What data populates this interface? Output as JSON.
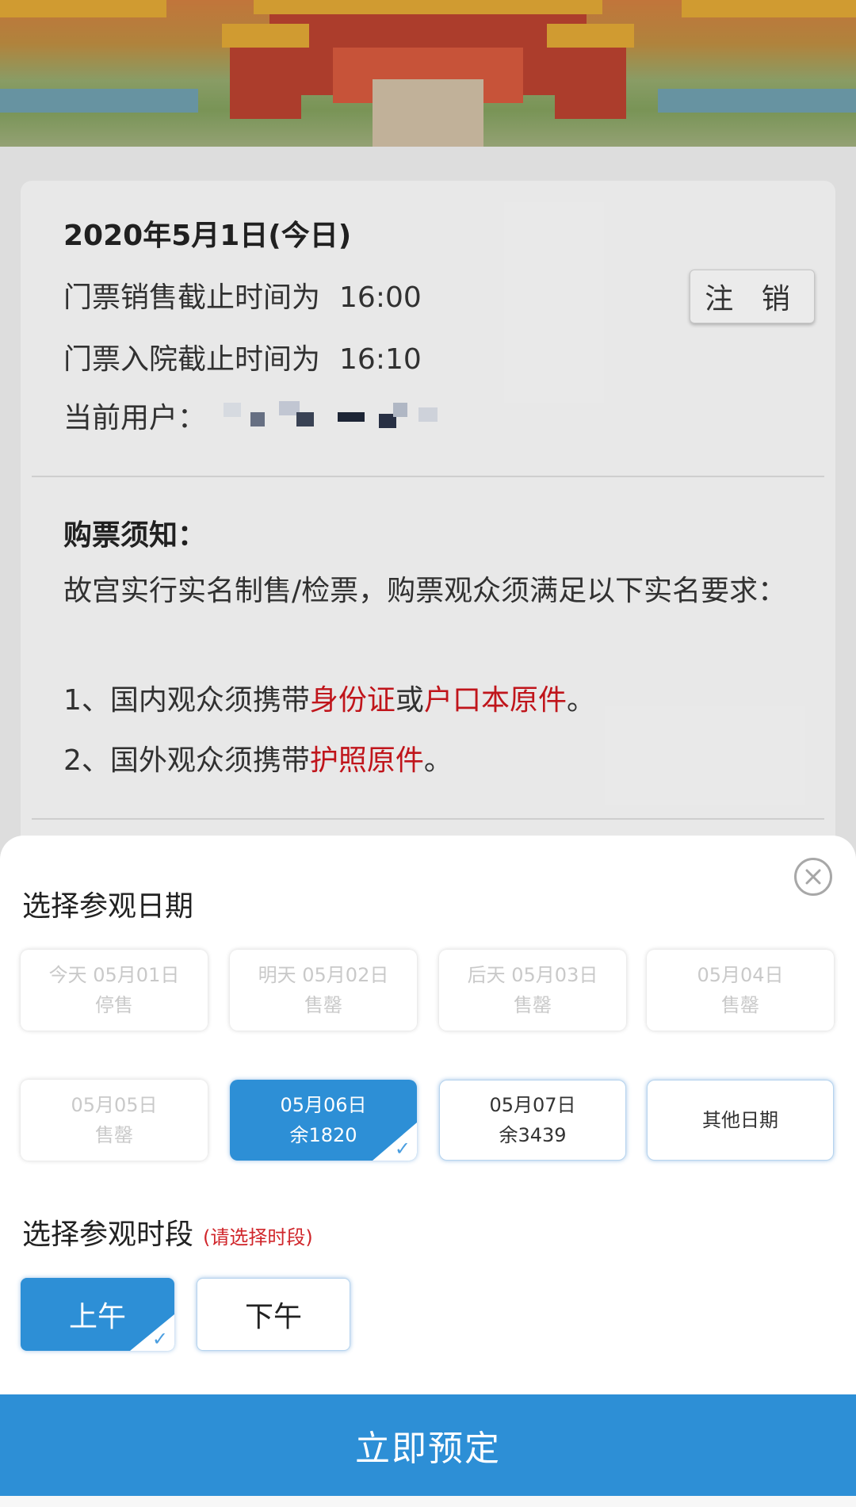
{
  "info": {
    "date_title": "2020年5月1日(今日)",
    "sale_cutoff_label": "门票销售截止时间为",
    "sale_cutoff_time": "16:00",
    "entry_cutoff_label": "门票入院截止时间为",
    "entry_cutoff_time": "16:10",
    "current_user_label": "当前用户：",
    "logout_label": "注 销"
  },
  "notice": {
    "title": "购票须知：",
    "body": "故宫实行实名制售/检票，购票观众须满足以下实名要求：",
    "item1_prefix": "1、国内观众须携带",
    "item1_red1": "身份证",
    "item1_mid": "或",
    "item1_red2": "户口本原件",
    "item1_suffix": "。",
    "item2_prefix": "2、国外观众须携带",
    "item2_red": "护照原件",
    "item2_suffix": "。"
  },
  "sheet": {
    "date_heading": "选择参观日期",
    "dates": [
      {
        "line1": "今天 05月01日",
        "line2": "停售"
      },
      {
        "line1": "明天 05月02日",
        "line2": "售罄"
      },
      {
        "line1": "后天 05月03日",
        "line2": "售罄"
      },
      {
        "line1": "05月04日",
        "line2": "售罄"
      },
      {
        "line1": "05月05日",
        "line2": "售罄"
      },
      {
        "line1": "05月06日",
        "line2": "余1820"
      },
      {
        "line1": "05月07日",
        "line2": "余3439"
      },
      {
        "line1": "其他日期",
        "line2": ""
      }
    ],
    "slot_heading": "选择参观时段",
    "slot_hint": "(请选择时段)",
    "slots": [
      {
        "label": "上午"
      },
      {
        "label": "下午"
      }
    ],
    "book_label": "立即预定"
  },
  "colors": {
    "accent": "#2d8fd6",
    "warning": "#c8161d"
  },
  "icons": {
    "close": "close-circle-icon",
    "check": "check-icon"
  }
}
